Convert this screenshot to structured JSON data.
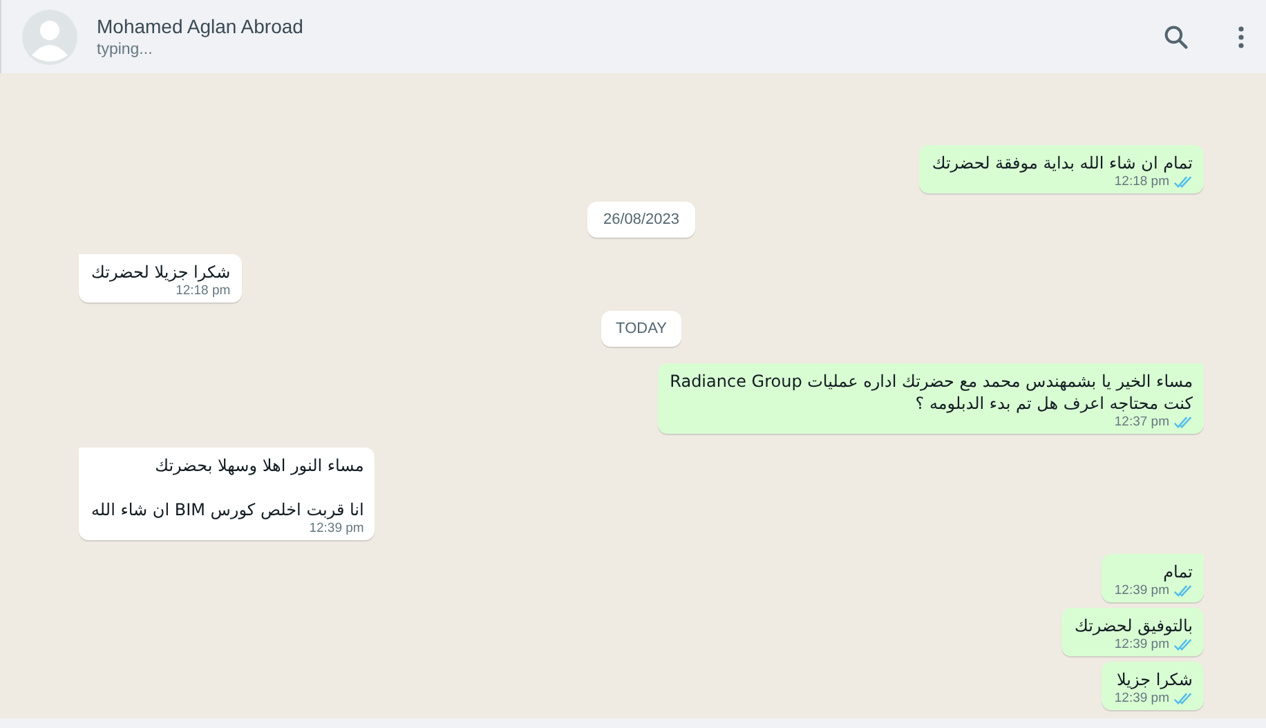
{
  "header": {
    "name": "Mohamed Aglan Abroad",
    "status": "typing..."
  },
  "messages": [
    {
      "kind": "outgoing",
      "text": "تمام ان شاء الله بداية موفقة لحضرتك",
      "time": "12:18 pm",
      "read": true,
      "tail": false
    },
    {
      "kind": "date",
      "text": "26/08/2023"
    },
    {
      "kind": "incoming",
      "text": "شكرا جزيلا لحضرتك",
      "time": "12:18 pm",
      "tail": true
    },
    {
      "kind": "date",
      "text": "TODAY"
    },
    {
      "kind": "outgoing",
      "text": "مساء الخير يا بشمهندس محمد  مع حضرتك اداره عمليات Radiance Group\nكنت محتاجه اعرف هل تم بدء الدبلومه ؟",
      "time": "12:37 pm",
      "read": true,
      "tail": true
    },
    {
      "kind": "incoming",
      "text": "مساء النور اهلا وسهلا بحضرتك\n\nانا قربت اخلص كورس BIM ان شاء الله",
      "time": "12:39 pm",
      "tail": true
    },
    {
      "kind": "outgoing",
      "text": "تمام",
      "time": "12:39 pm",
      "read": true,
      "tail": true
    },
    {
      "kind": "outgoing",
      "text": "بالتوفيق لحضرتك",
      "time": "12:39 pm",
      "read": true,
      "tail": false
    },
    {
      "kind": "outgoing",
      "text": "شكرا جزيلا",
      "time": "12:39 pm",
      "read": true,
      "tail": false
    }
  ]
}
